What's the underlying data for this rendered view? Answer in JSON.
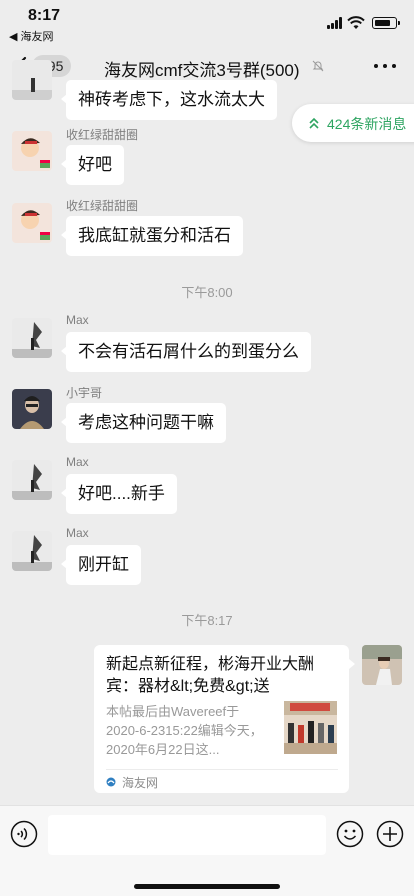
{
  "status_bar": {
    "time": "8:17",
    "back_app": "◀ 海友网",
    "battery_percent": 80
  },
  "nav": {
    "unread_count": "695",
    "title": "海友网cmf交流3号群(500)"
  },
  "new_messages": "424条新消息",
  "messages": [
    {
      "sender": "",
      "text": "神砖考虑下，这水流太大"
    },
    {
      "sender": "收红绿甜甜圈",
      "text": "好吧"
    },
    {
      "sender": "收红绿甜甜圈",
      "text": "我底缸就蛋分和活石"
    },
    {
      "sender": "Max",
      "text": "不会有活石屑什么的到蛋分么"
    },
    {
      "sender": "小宇哥",
      "text": "考虑这种问题干嘛"
    },
    {
      "sender": "Max",
      "text": "好吧....新手"
    },
    {
      "sender": "Max",
      "text": "刚开缸"
    }
  ],
  "timestamps": [
    "下午8:00",
    "下午8:17"
  ],
  "link_card": {
    "title": "新起点新征程，彬海开业大酬宾：器材&lt;免费&gt;送",
    "description": "本帖最后由Wavereef于 2020-6-2315:22编辑今天，2020年6月22日这...",
    "source": "海友网"
  },
  "input": {
    "placeholder": ""
  },
  "icons": {
    "back": "chevron-left-icon",
    "mute": "bell-muted-icon",
    "more": "more-icon",
    "voice": "voice-icon",
    "emoji": "emoji-icon",
    "plus": "plus-icon"
  },
  "colors": {
    "accent": "#2fa562",
    "background": "#ededed"
  }
}
